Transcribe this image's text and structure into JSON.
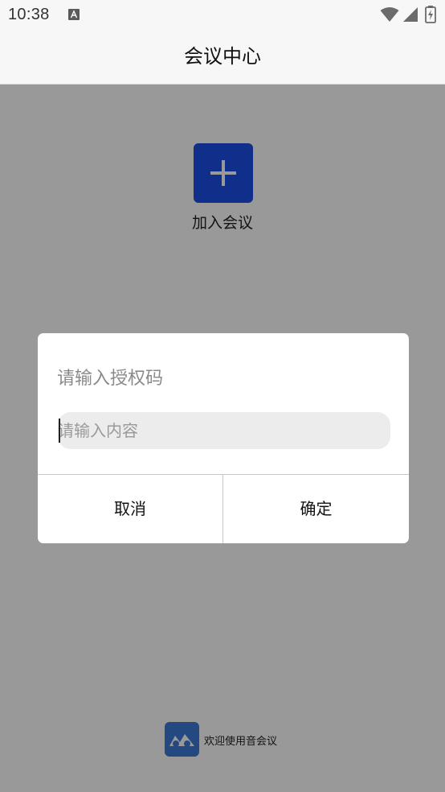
{
  "status_bar": {
    "time": "10:38",
    "icons": [
      "notification-a-icon",
      "wifi-icon",
      "signal-icon",
      "battery-charging-icon"
    ]
  },
  "app_bar": {
    "title": "会议中心"
  },
  "main": {
    "join_meeting": {
      "label": "加入会议",
      "icon": "plus-icon"
    },
    "footer": {
      "logo_icon": "app-logo-icon",
      "text": "欢迎使用音会议"
    }
  },
  "dialog": {
    "title": "请输入授权码",
    "input": {
      "value": "",
      "placeholder": "请输入内容"
    },
    "cancel_label": "取消",
    "confirm_label": "确定"
  },
  "colors": {
    "accent": "#1c4fe6",
    "logo": "#3d78d6",
    "scrim": "rgba(0,0,0,0.40)"
  }
}
